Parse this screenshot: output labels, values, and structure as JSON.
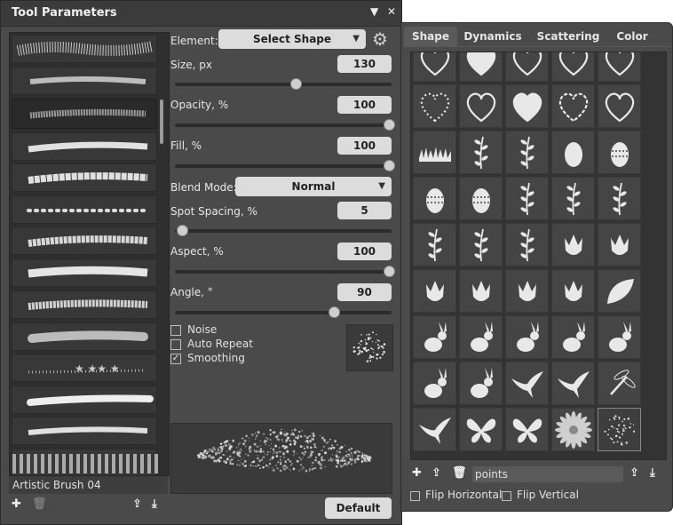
{
  "tool_panel": {
    "title": "Tool Parameters",
    "brush_name": "Artistic Brush 04",
    "element_label": "Element:",
    "element_value": "Select Shape",
    "params": [
      {
        "label": "Size, px",
        "value": "130",
        "fraction": 0.56
      },
      {
        "label": "Opacity, %",
        "value": "100",
        "fraction": 1.0
      },
      {
        "label": "Fill, %",
        "value": "100",
        "fraction": 1.0
      },
      {
        "label": "Spot Spacing, %",
        "value": "5",
        "fraction": 0.02
      },
      {
        "label": "Aspect, %",
        "value": "100",
        "fraction": 1.0
      },
      {
        "label": "Angle, °",
        "value": "90",
        "fraction": 0.74
      }
    ],
    "blend_label": "Blend Mode:",
    "blend_value": "Normal",
    "checkboxes": [
      {
        "label": "Noise",
        "checked": false
      },
      {
        "label": "Auto Repeat",
        "checked": false
      },
      {
        "label": "Smoothing",
        "checked": true
      }
    ],
    "default_label": "Default"
  },
  "shape_panel": {
    "tabs": [
      "Shape",
      "Dynamics",
      "Scattering",
      "Color"
    ],
    "active_tab": 0,
    "search_value": "points",
    "flip_horizontal": "Flip Horizontal",
    "flip_vertical": "Flip Vertical",
    "shapes": [
      "heart-outline-icon",
      "heart-filled-icon",
      "heart-sketch-icon",
      "heart-hatched-icon",
      "heart-double-icon",
      "heart-dotted-icon",
      "heart-arrow-icon",
      "heart-striped-icon",
      "heart-dashed-icon",
      "heart-scribble-icon",
      "grass-icon",
      "branch-ornament-icon",
      "branch-berries-icon",
      "egg-cracked-icon",
      "egg-patterned-icon",
      "egg-dotted-icon",
      "egg-spotted-icon",
      "twig-dots-icon",
      "twig-thin-icon",
      "fern-icon",
      "sprig-icon",
      "sprig-leaves-icon",
      "sprig-small-icon",
      "tulip-sprig-icon",
      "lotus-icon",
      "tulip-icon",
      "tulip-leaves-icon",
      "tulip-round-icon",
      "tulip-sprout-icon",
      "leaf-icon",
      "rabbit-running-icon",
      "rabbit-leaping-icon",
      "rabbit-sitting-icon",
      "rabbit-standing-icon",
      "rabbits-pair-icon",
      "rabbit-icon",
      "rabbit-crouching-icon",
      "swallow-icon",
      "swallow-flying-icon",
      "dragonfly-icon",
      "birds-icon",
      "butterfly-icon",
      "butterfly-spread-icon",
      "flower-icon",
      "points-icon"
    ],
    "selected_shape": 44
  }
}
